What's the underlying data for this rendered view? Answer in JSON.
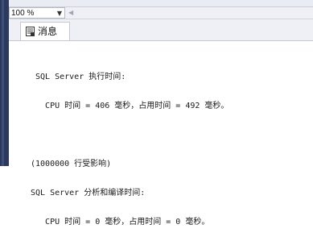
{
  "toolbar": {
    "zoom_value": "100 %",
    "zoom_dropdown_icon": "chevron-down-icon",
    "scroll_left_icon": "chevron-left-icon"
  },
  "results_tabs": {
    "messages_tab": {
      "label": "消息",
      "icon": "messages-icon"
    }
  },
  "messages": {
    "lines": [
      " SQL Server 执行时间:",
      "   CPU 时间 = 406 毫秒，占用时间 = 492 毫秒。",
      "",
      "(1000000 行受影响)",
      "SQL Server 分析和编译时间:",
      "   CPU 时间 = 0 毫秒，占用时间 = 0 毫秒。"
    ]
  },
  "colors": {
    "frame_dark": "#2b3a5c",
    "toolbar_bg": "#eef0f5",
    "pane_bg": "#ffffff"
  }
}
